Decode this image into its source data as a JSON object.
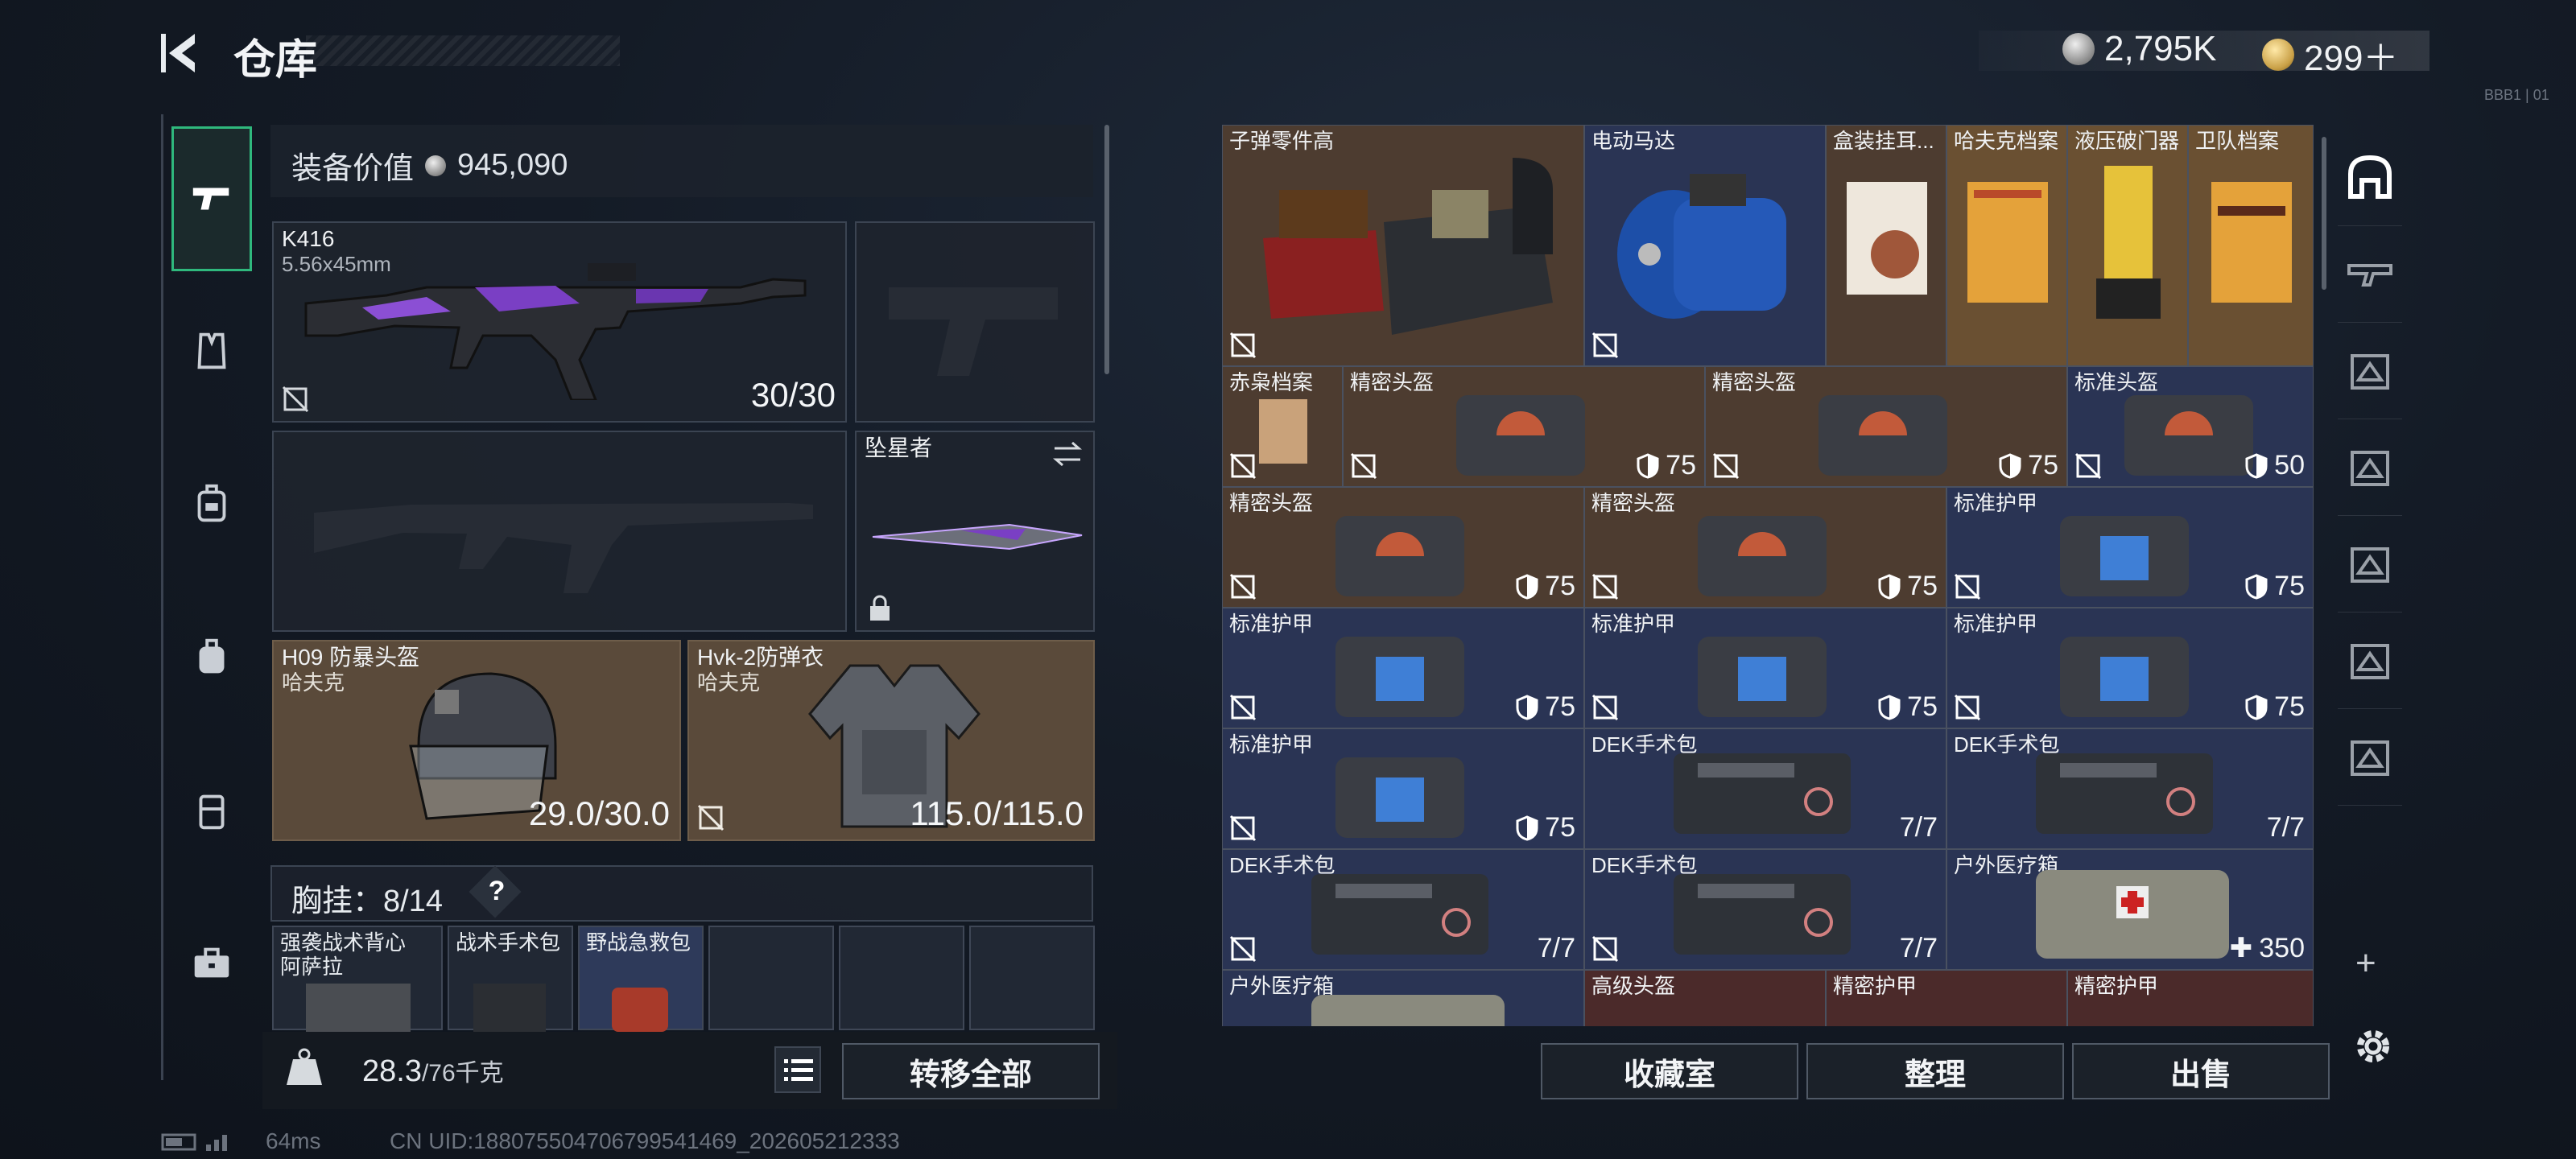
{
  "header": {
    "title": "仓库",
    "currency_silver": "2,795K",
    "currency_gold": "299＋",
    "tiny_tag": "BBB1 | 01"
  },
  "nav": {
    "items": [
      "pistol-icon",
      "vest-icon",
      "chest-rig-icon",
      "backpack-icon",
      "case-icon",
      "toolbox-icon"
    ]
  },
  "loadout": {
    "value_label": "装备价值",
    "value": "945,090",
    "primary": {
      "name": "K416",
      "caliber": "5.56x45mm",
      "ammo": "30/30"
    },
    "melee": {
      "name": "坠星者"
    },
    "helmet": {
      "name": "H09 防暴头盔",
      "brand": "哈夫克",
      "durability": "29.0/30.0"
    },
    "armor": {
      "name": "Hvk-2防弹衣",
      "brand": "哈夫克",
      "durability": "115.0/115.0"
    },
    "chest": {
      "label": "胸挂：",
      "count": "8/14",
      "help": "?",
      "slots": [
        {
          "name": "强袭战术背心",
          "sub": "阿萨拉"
        },
        {
          "name": "战术手术包"
        },
        {
          "name": "野战急救包"
        }
      ]
    },
    "weight": "28.3",
    "weight_max": "/76千克",
    "transfer_all": "转移全部"
  },
  "stash": {
    "items": [
      {
        "name": "子弹零件高"
      },
      {
        "name": "电动马达"
      },
      {
        "name": "盒装挂耳..."
      },
      {
        "name": "哈夫克档案"
      },
      {
        "name": "液压破门器"
      },
      {
        "name": "卫队档案"
      },
      {
        "name": "赤枭档案"
      },
      {
        "name": "精密头盔",
        "dur": "75"
      },
      {
        "name": "精密头盔",
        "dur": "75"
      },
      {
        "name": "标准头盔",
        "dur": "50"
      },
      {
        "name": "精密头盔",
        "dur": "75"
      },
      {
        "name": "精密头盔",
        "dur": "75"
      },
      {
        "name": "标准护甲",
        "dur": "75"
      },
      {
        "name": "标准护甲",
        "dur": "75"
      },
      {
        "name": "标准护甲",
        "dur": "75"
      },
      {
        "name": "标准护甲",
        "dur": "75"
      },
      {
        "name": "标准护甲",
        "dur": "75"
      },
      {
        "name": "DEK手术包",
        "dur": "7/7"
      },
      {
        "name": "DEK手术包",
        "dur": "7/7"
      },
      {
        "name": "DEK手术包",
        "dur": "7/7"
      },
      {
        "name": "DEK手术包",
        "dur": "7/7"
      },
      {
        "name": "户外医疗箱",
        "dur": "350"
      },
      {
        "name": "户外医疗箱"
      },
      {
        "name": "高级头盔"
      },
      {
        "name": "精密护甲"
      },
      {
        "name": "精密护甲"
      }
    ],
    "buttons": {
      "collection": "收藏室",
      "sort": "整理",
      "sell": "出售"
    }
  },
  "footer": {
    "ping": "64ms",
    "uid": "CN UID:1880755047067995414​69_202605212333"
  }
}
